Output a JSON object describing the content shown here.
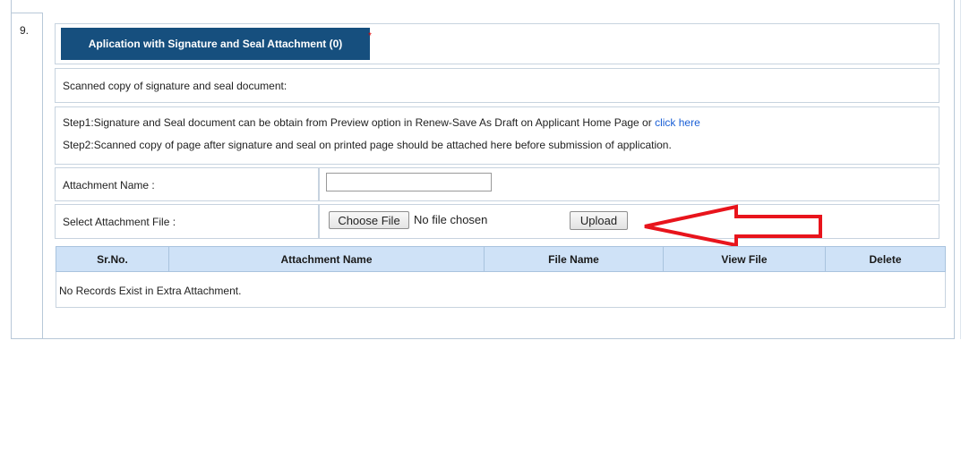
{
  "section": {
    "number": "9.",
    "title_button": "Aplication with Signature and Seal Attachment (0)",
    "required_mark": "*"
  },
  "scanned_label": "Scanned copy of signature and seal document:",
  "steps": {
    "step1_text": "Step1:Signature and Seal document can be obtain from Preview option in Renew-Save As Draft on Applicant Home Page   or ",
    "step1_link": "click here",
    "step2_text": "Step2:Scanned copy of page after signature and seal on printed page should be attached here before submission of application."
  },
  "form": {
    "attachment_name_label": "Attachment Name :",
    "attachment_name_value": "",
    "select_file_label": "Select Attachment File :",
    "choose_file_button": "Choose File",
    "no_file_text": "No file chosen",
    "upload_button": "Upload"
  },
  "table": {
    "headers": [
      "Sr.No.",
      "Attachment Name",
      "File Name",
      "View File",
      "Delete"
    ],
    "empty_message": "No Records Exist in Extra Attachment."
  },
  "colors": {
    "title_bg": "#164f7e",
    "header_bg": "#cfe2f7",
    "arrow": "#e8141c",
    "link": "#1a5fd6"
  },
  "icons": {
    "annotation": "arrow-left-icon"
  }
}
